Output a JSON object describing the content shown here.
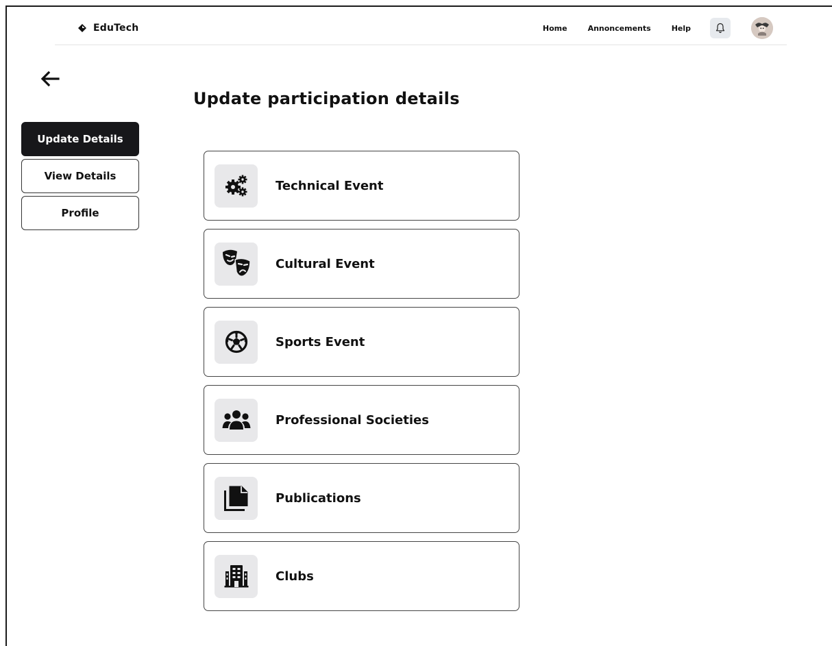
{
  "header": {
    "brand": "EduTech",
    "nav": [
      "Home",
      "Annoncements",
      "Help"
    ]
  },
  "page": {
    "title": "Update participation details"
  },
  "sidebar": {
    "items": [
      {
        "label": "Update Details",
        "active": true
      },
      {
        "label": "View Details",
        "active": false
      },
      {
        "label": "Profile",
        "active": false
      }
    ]
  },
  "events": [
    {
      "label": "Technical Event",
      "icon": "gears-icon"
    },
    {
      "label": "Cultural Event",
      "icon": "theater-masks-icon"
    },
    {
      "label": "Sports Event",
      "icon": "soccer-ball-icon"
    },
    {
      "label": "Professional Societies",
      "icon": "people-group-icon"
    },
    {
      "label": "Publications",
      "icon": "documents-icon"
    },
    {
      "label": "Clubs",
      "icon": "building-icon"
    }
  ],
  "colors": {
    "primary_dark": "#17171a",
    "icon_background": "#e8e8ea"
  }
}
